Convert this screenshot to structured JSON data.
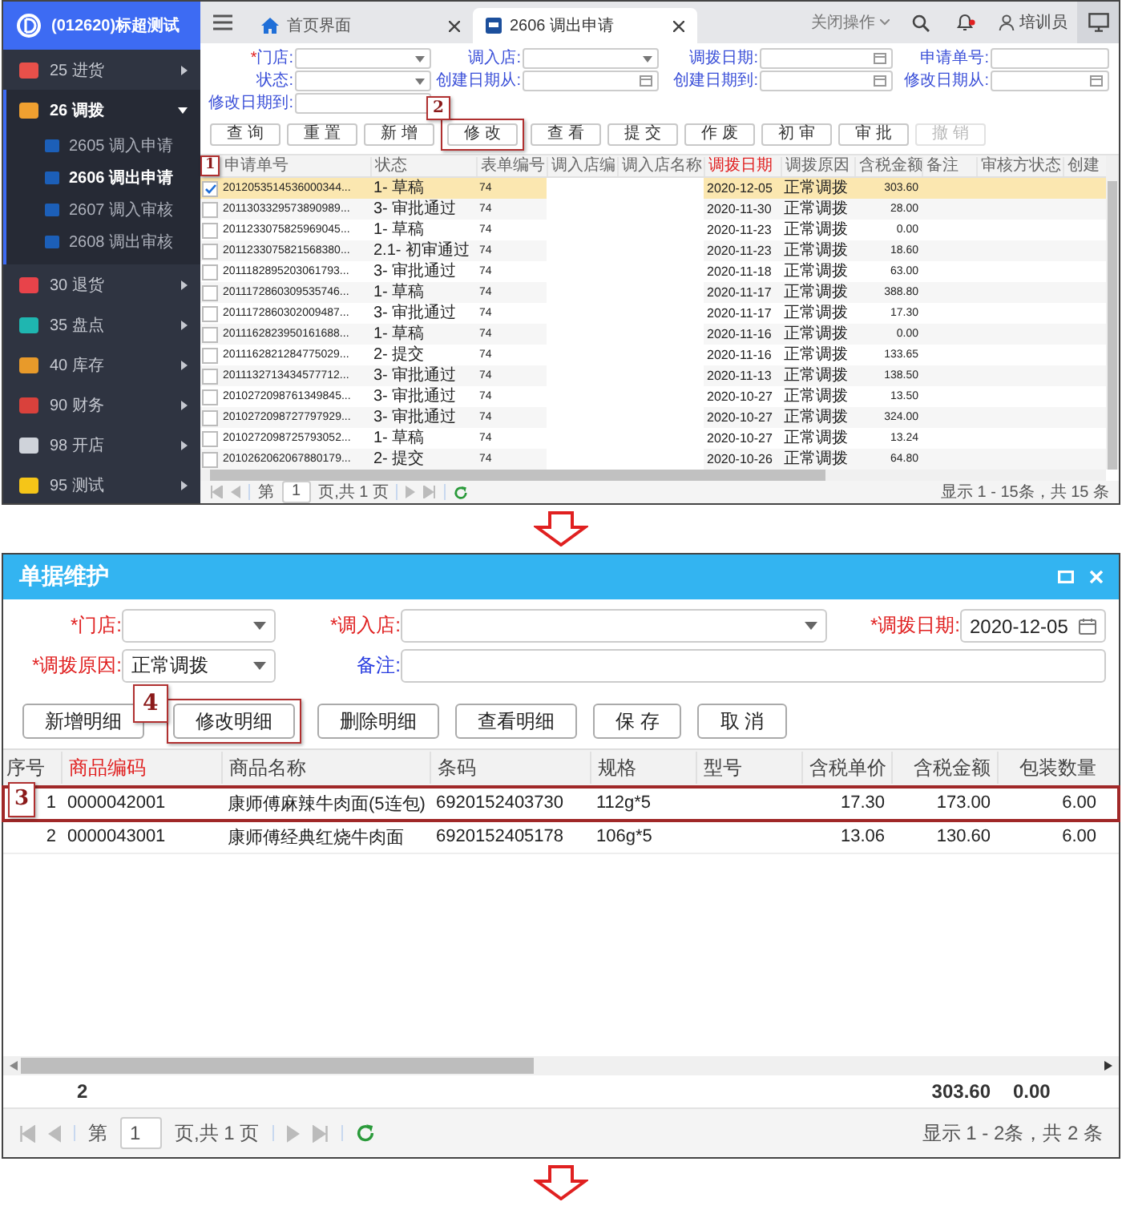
{
  "app": {
    "brand": "(012620)标超测试",
    "sidebar": [
      {
        "label": "25 进货",
        "color": "#e8504a",
        "expanded": false
      },
      {
        "label": "26 调拨",
        "color": "#f0a030",
        "expanded": true,
        "children": [
          {
            "label": "2605 调入申请",
            "selected": false
          },
          {
            "label": "2606 调出申请",
            "selected": true
          },
          {
            "label": "2607 调入审核",
            "selected": false
          },
          {
            "label": "2608 调出审核",
            "selected": false
          }
        ]
      },
      {
        "label": "30 退货",
        "color": "#e8434a",
        "expanded": false
      },
      {
        "label": "35 盘点",
        "color": "#1fb6b0",
        "expanded": false
      },
      {
        "label": "40 库存",
        "color": "#e89a2a",
        "expanded": false
      },
      {
        "label": "90 财务",
        "color": "#d9413c",
        "expanded": false
      },
      {
        "label": "98 开店",
        "color": "#cfd3da",
        "expanded": false
      },
      {
        "label": "95 测试",
        "color": "#f5c518",
        "expanded": false
      }
    ],
    "tabs": [
      {
        "label": "首页界面",
        "kind": "home",
        "selected": false
      },
      {
        "label": "2606 调出申请",
        "kind": "doc",
        "selected": true
      }
    ],
    "close_menu": "关闭操作",
    "user": "培训员",
    "filters": [
      {
        "mark": "*",
        "label": "门店:",
        "kind": "select"
      },
      {
        "label": "调入店:",
        "kind": "select"
      },
      {
        "label": "调拨日期:",
        "kind": "date"
      },
      {
        "label": "申请单号:",
        "kind": "text"
      },
      {
        "label": "状态:",
        "kind": "select"
      },
      {
        "label": "创建日期从:",
        "kind": "date"
      },
      {
        "label": "创建日期到:",
        "kind": "date"
      },
      {
        "label": "修改日期从:",
        "kind": "date"
      },
      {
        "label": "修改日期到:",
        "kind": "text"
      }
    ],
    "buttons": [
      {
        "label": "查 询",
        "disabled": false
      },
      {
        "label": "重 置",
        "disabled": false
      },
      {
        "label": "新 增",
        "disabled": false
      },
      {
        "label": "修 改",
        "disabled": false,
        "callout": "2"
      },
      {
        "label": "查 看",
        "disabled": false
      },
      {
        "label": "提 交",
        "disabled": false
      },
      {
        "label": "作 废",
        "disabled": false
      },
      {
        "label": "初 审",
        "disabled": false
      },
      {
        "label": "审 批",
        "disabled": false
      },
      {
        "label": "撤 销",
        "disabled": true
      }
    ],
    "columns": [
      {
        "label": "申请单号",
        "accent": false
      },
      {
        "label": "状态",
        "accent": false
      },
      {
        "label": "表单编号",
        "accent": false
      },
      {
        "label": "调入店编",
        "accent": false
      },
      {
        "label": "调入店名称",
        "accent": false
      },
      {
        "label": "调拨日期",
        "accent": true
      },
      {
        "label": "调拨原因",
        "accent": false
      },
      {
        "label": "含税金额",
        "accent": false
      },
      {
        "label": "备注",
        "accent": false
      },
      {
        "label": "审核方状态",
        "accent": false
      },
      {
        "label": "创建",
        "accent": false
      }
    ],
    "rows": [
      {
        "number": "2012053514536000344...",
        "status": "1- 草稿",
        "form_no": "74",
        "date": "2020-12-05",
        "reason": "正常调拨",
        "amount": "303.60",
        "selected": true,
        "checked": true,
        "callout": "1"
      },
      {
        "number": "2011303329573890989...",
        "status": "3- 审批通过",
        "form_no": "74",
        "date": "2020-11-30",
        "reason": "正常调拨",
        "amount": "28.00",
        "selected": false,
        "checked": false
      },
      {
        "number": "2011233075825969045...",
        "status": "1- 草稿",
        "form_no": "74",
        "date": "2020-11-23",
        "reason": "正常调拨",
        "amount": "0.00",
        "selected": false,
        "checked": false
      },
      {
        "number": "2011233075821568380...",
        "status": "2.1- 初审通过",
        "form_no": "74",
        "date": "2020-11-23",
        "reason": "正常调拨",
        "amount": "18.60",
        "selected": false,
        "checked": false
      },
      {
        "number": "2011182895203061793...",
        "status": "3- 审批通过",
        "form_no": "74",
        "date": "2020-11-18",
        "reason": "正常调拨",
        "amount": "63.00",
        "selected": false,
        "checked": false
      },
      {
        "number": "2011172860309535746...",
        "status": "1- 草稿",
        "form_no": "74",
        "date": "2020-11-17",
        "reason": "正常调拨",
        "amount": "388.80",
        "selected": false,
        "checked": false
      },
      {
        "number": "2011172860302009487...",
        "status": "3- 审批通过",
        "form_no": "74",
        "date": "2020-11-17",
        "reason": "正常调拨",
        "amount": "17.30",
        "selected": false,
        "checked": false
      },
      {
        "number": "2011162823950161688...",
        "status": "1- 草稿",
        "form_no": "74",
        "date": "2020-11-16",
        "reason": "正常调拨",
        "amount": "0.00",
        "selected": false,
        "checked": false
      },
      {
        "number": "2011162821284775029...",
        "status": "2- 提交",
        "form_no": "74",
        "date": "2020-11-16",
        "reason": "正常调拨",
        "amount": "133.65",
        "selected": false,
        "checked": false
      },
      {
        "number": "2011132713434577712...",
        "status": "3- 审批通过",
        "form_no": "74",
        "date": "2020-11-13",
        "reason": "正常调拨",
        "amount": "138.50",
        "selected": false,
        "checked": false
      },
      {
        "number": "2010272098761349845...",
        "status": "3- 审批通过",
        "form_no": "74",
        "date": "2020-10-27",
        "reason": "正常调拨",
        "amount": "13.50",
        "selected": false,
        "checked": false
      },
      {
        "number": "2010272098727797929...",
        "status": "3- 审批通过",
        "form_no": "74",
        "date": "2020-10-27",
        "reason": "正常调拨",
        "amount": "324.00",
        "selected": false,
        "checked": false
      },
      {
        "number": "2010272098725793052...",
        "status": "1- 草稿",
        "form_no": "74",
        "date": "2020-10-27",
        "reason": "正常调拨",
        "amount": "13.24",
        "selected": false,
        "checked": false
      },
      {
        "number": "2010262062067880179...",
        "status": "2- 提交",
        "form_no": "74",
        "date": "2020-10-26",
        "reason": "正常调拨",
        "amount": "64.80",
        "selected": false,
        "checked": false
      }
    ],
    "pager": {
      "prefix": "第",
      "page": "1",
      "suffix": "页,共 1 页",
      "summary": "显示 1 - 15条，共 15 条"
    }
  },
  "dialog": {
    "title": "单据维护",
    "fields": [
      {
        "label": "*门店:",
        "required": true,
        "kind": "select"
      },
      {
        "label": "*调入店:",
        "required": true,
        "kind": "select"
      },
      {
        "label": "*调拨日期:",
        "required": true,
        "kind": "date",
        "value": "2020-12-05"
      },
      {
        "label": "*调拨原因:",
        "required": true,
        "kind": "select",
        "value": "正常调拨"
      },
      {
        "label": "备注:",
        "required": false,
        "kind": "text"
      }
    ],
    "buttons": [
      {
        "label": "新增明细"
      },
      {
        "label": "修改明细",
        "callout": "4"
      },
      {
        "label": "删除明细"
      },
      {
        "label": "查看明细"
      },
      {
        "label": "保 存"
      },
      {
        "label": "取 消"
      }
    ],
    "columns": [
      {
        "label": "序号",
        "accent": false
      },
      {
        "label": "商品编码",
        "accent": true
      },
      {
        "label": "商品名称",
        "accent": false
      },
      {
        "label": "条码",
        "accent": false
      },
      {
        "label": "规格",
        "accent": false
      },
      {
        "label": "型号",
        "accent": false
      },
      {
        "label": "含税单价",
        "accent": false
      },
      {
        "label": "含税金额",
        "accent": false
      },
      {
        "label": "包装数量",
        "accent": false
      }
    ],
    "rows": [
      {
        "index": "1",
        "code": "0000042001",
        "name": "康师傅麻辣牛肉面(5连包)",
        "barcode": "6920152403730",
        "spec": "112g*5",
        "price": "17.30",
        "amount": "173.00",
        "qty": "6.00",
        "callout": "3"
      },
      {
        "index": "2",
        "code": "0000043001",
        "name": "康师傅经典红烧牛肉面",
        "barcode": "6920152405178",
        "spec": "106g*5",
        "price": "13.06",
        "amount": "130.60",
        "qty": "6.00"
      }
    ],
    "totals": {
      "count": "2",
      "amount": "303.60",
      "qty": "0.00"
    },
    "pager": {
      "prefix": "第",
      "page": "1",
      "suffix": "页,共 1 页",
      "summary": "显示 1 - 2条，共 2 条"
    }
  }
}
